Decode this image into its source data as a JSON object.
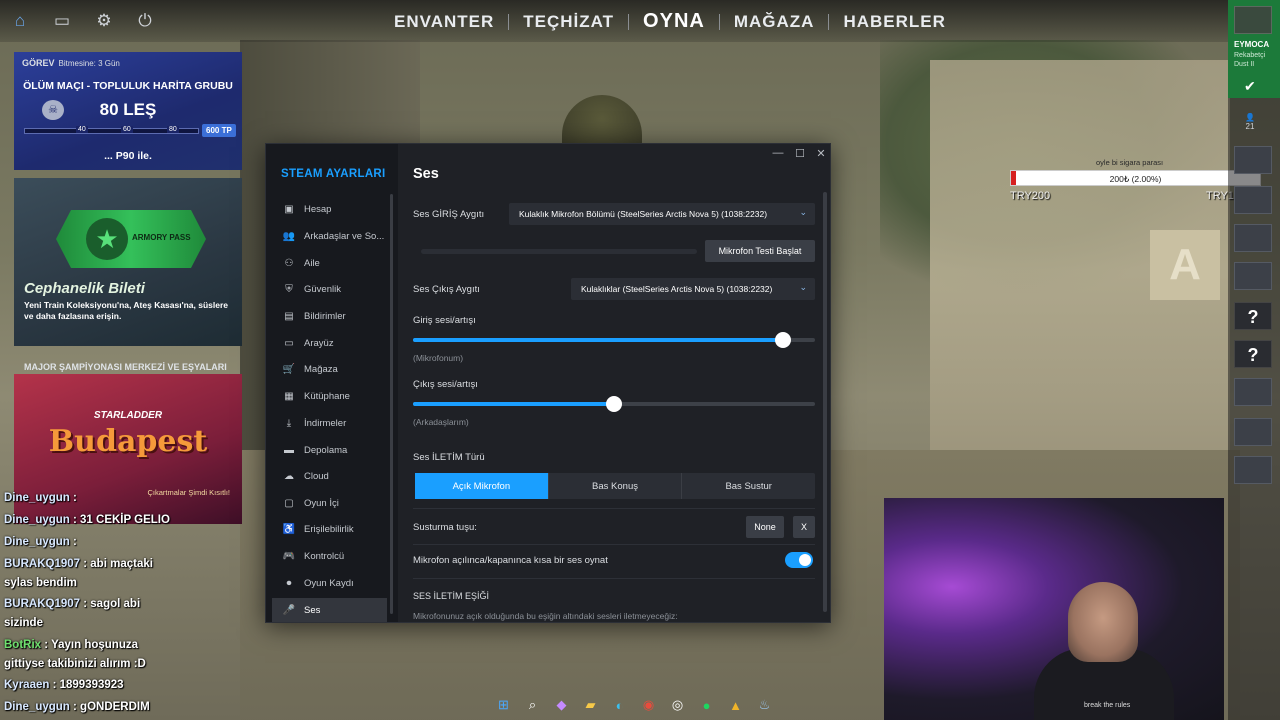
{
  "topnav": {
    "items": [
      "ENVANTER",
      "TEÇHİZAT",
      "OYNA",
      "MAĞAZA",
      "HABERLER"
    ],
    "active": "OYNA"
  },
  "mission": {
    "label": "GÖREV",
    "time": "Bitmesine: 3 Gün",
    "name": "ÖLÜM MAÇI - TOPLULUK HARİTA GRUBU",
    "kills": "80 LEŞ",
    "ticks": [
      "40",
      "60",
      "80"
    ],
    "reward": "600 TP",
    "weapon": "... P90 ile."
  },
  "armory": {
    "badge": "ARMORY PASS",
    "title": "Cephanelik Bileti",
    "desc": "Yeni Train Koleksiyonu'na, Ateş Kasası'na, süslere ve daha fazlasına erişin."
  },
  "major": {
    "heading": "MAJOR ŞAMPİYONASI MERKEZİ VE EŞYALARI",
    "brand": "STARLADDER",
    "city": "Budapest",
    "cta": "Çıkartmalar Şimdi Kısıtlı!"
  },
  "chat": [
    {
      "user": "Dine_uygun",
      "msg": ":",
      "kind": "user"
    },
    {
      "user": "Dine_uygun",
      "msg": ": 31 CEKİP GELIO",
      "kind": "user"
    },
    {
      "user": "Dine_uygun",
      "msg": ":",
      "kind": "user"
    },
    {
      "user": "BURAKQ1907",
      "msg": ": abi maçtaki",
      "kind": "user"
    },
    {
      "user": "",
      "msg": "sylas bendim",
      "kind": "cont"
    },
    {
      "user": "BURAKQ1907",
      "msg": ": sagol abi",
      "kind": "user"
    },
    {
      "user": "",
      "msg": "sizinde",
      "kind": "cont"
    },
    {
      "user": "BotRix",
      "msg": ": Yayın hoşunuza",
      "kind": "bot"
    },
    {
      "user": "",
      "msg": "gittiyse takibinizi alırım :D",
      "kind": "cont"
    },
    {
      "user": "Kyraaen",
      "msg": ": 1899393923",
      "kind": "user"
    },
    {
      "user": "Dine_uygun",
      "msg": ": gONDERDIM",
      "kind": "user"
    }
  ],
  "settings": {
    "title": "STEAM AYARLARI",
    "sidebar": [
      "Hesap",
      "Arkadaşlar ve So...",
      "Aile",
      "Güvenlik",
      "Bildirimler",
      "Arayüz",
      "Mağaza",
      "Kütüphane",
      "İndirmeler",
      "Depolama",
      "Cloud",
      "Oyun İçi",
      "Erişilebilirlik",
      "Kontrolcü",
      "Oyun Kaydı",
      "Ses"
    ],
    "active_index": 15,
    "page_title": "Ses",
    "input_label": "Ses GİRİŞ Aygıtı",
    "input_device": "Kulaklık Mikrofon Bölümü (SteelSeries Arctis Nova 5) (1038:2232)",
    "mic_test_button": "Mikrofon Testi Başlat",
    "output_label": "Ses Çıkış Aygıtı",
    "output_device": "Kulaklıklar (SteelSeries Arctis Nova 5) (1038:2232)",
    "input_volume_label": "Giriş sesi/artışı",
    "input_volume_sub": "(Mikrofonum)",
    "input_volume": 0.92,
    "output_volume_label": "Çıkış sesi/artışı",
    "output_volume_sub": "(Arkadaşlarım)",
    "output_volume": 0.5,
    "transmission_label": "Ses İLETİM Türü",
    "transmission_options": [
      "Açık Mikrofon",
      "Bas Konuş",
      "Bas Sustur"
    ],
    "transmission_selected": 0,
    "mute_key_label": "Susturma tuşu:",
    "mute_key_value": "None",
    "mute_key_clear": "X",
    "mic_sound_label": "Mikrofon açılınca/kapanınca kısa bir ses oynat",
    "mic_sound_on": true,
    "threshold_heading": "SES İLETİM EŞİĞİ",
    "threshold_desc": "Mikrofonunuz açık olduğunda bu eşiğin altındaki sesleri iletmeyeceğiz:"
  },
  "rail": {
    "friend_name": "EYMOCA",
    "friend_status": "Rekabetçi\nDust II",
    "friends_count": "21",
    "unknown": "?"
  },
  "donation": {
    "note": "oyle bi sigara parası",
    "progress_text": "200₺ (2.00%)",
    "progress": 0.02,
    "left_label": "TRY200",
    "right_label": "TRY10000"
  },
  "webcam": {
    "shirt_text": "break the rules"
  },
  "colors": {
    "accent": "#1a9fff",
    "sidebar_bg": "#17191e",
    "window_bg": "#1f2126",
    "friend_green": "#1c7a3a"
  }
}
